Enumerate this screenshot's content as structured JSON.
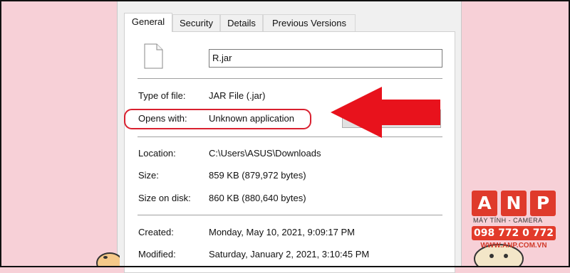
{
  "tabs": [
    {
      "label": "General"
    },
    {
      "label": "Security"
    },
    {
      "label": "Details"
    },
    {
      "label": "Previous Versions"
    }
  ],
  "file": {
    "name": "R.jar",
    "icon": "file-icon"
  },
  "properties": {
    "type_label": "Type of file:",
    "type_value": "JAR File (.jar)",
    "opens_label": "Opens with:",
    "opens_value": "Unknown application",
    "change_button": "Change...",
    "location_label": "Location:",
    "location_value": "C:\\Users\\ASUS\\Downloads",
    "size_label": "Size:",
    "size_value": "859 KB (879,972 bytes)",
    "size_on_disk_label": "Size on disk:",
    "size_on_disk_value": "860 KB (880,640 bytes)",
    "created_label": "Created:",
    "created_value": "Monday, May 10, 2021, 9:09:17 PM",
    "modified_label": "Modified:",
    "modified_value": "Saturday, January 2, 2021, 3:10:45 PM"
  },
  "annotation": {
    "highlight_color": "#d9202f",
    "arrow_color": "#e8121c"
  },
  "watermark": {
    "letters": [
      "A",
      "N",
      "P"
    ],
    "caption": "MÁY TÍNH - CAMERA",
    "phone": "098 772 0 772",
    "website": "WWW.ANP.COM.VN",
    "brand_color": "#df3a2b"
  }
}
